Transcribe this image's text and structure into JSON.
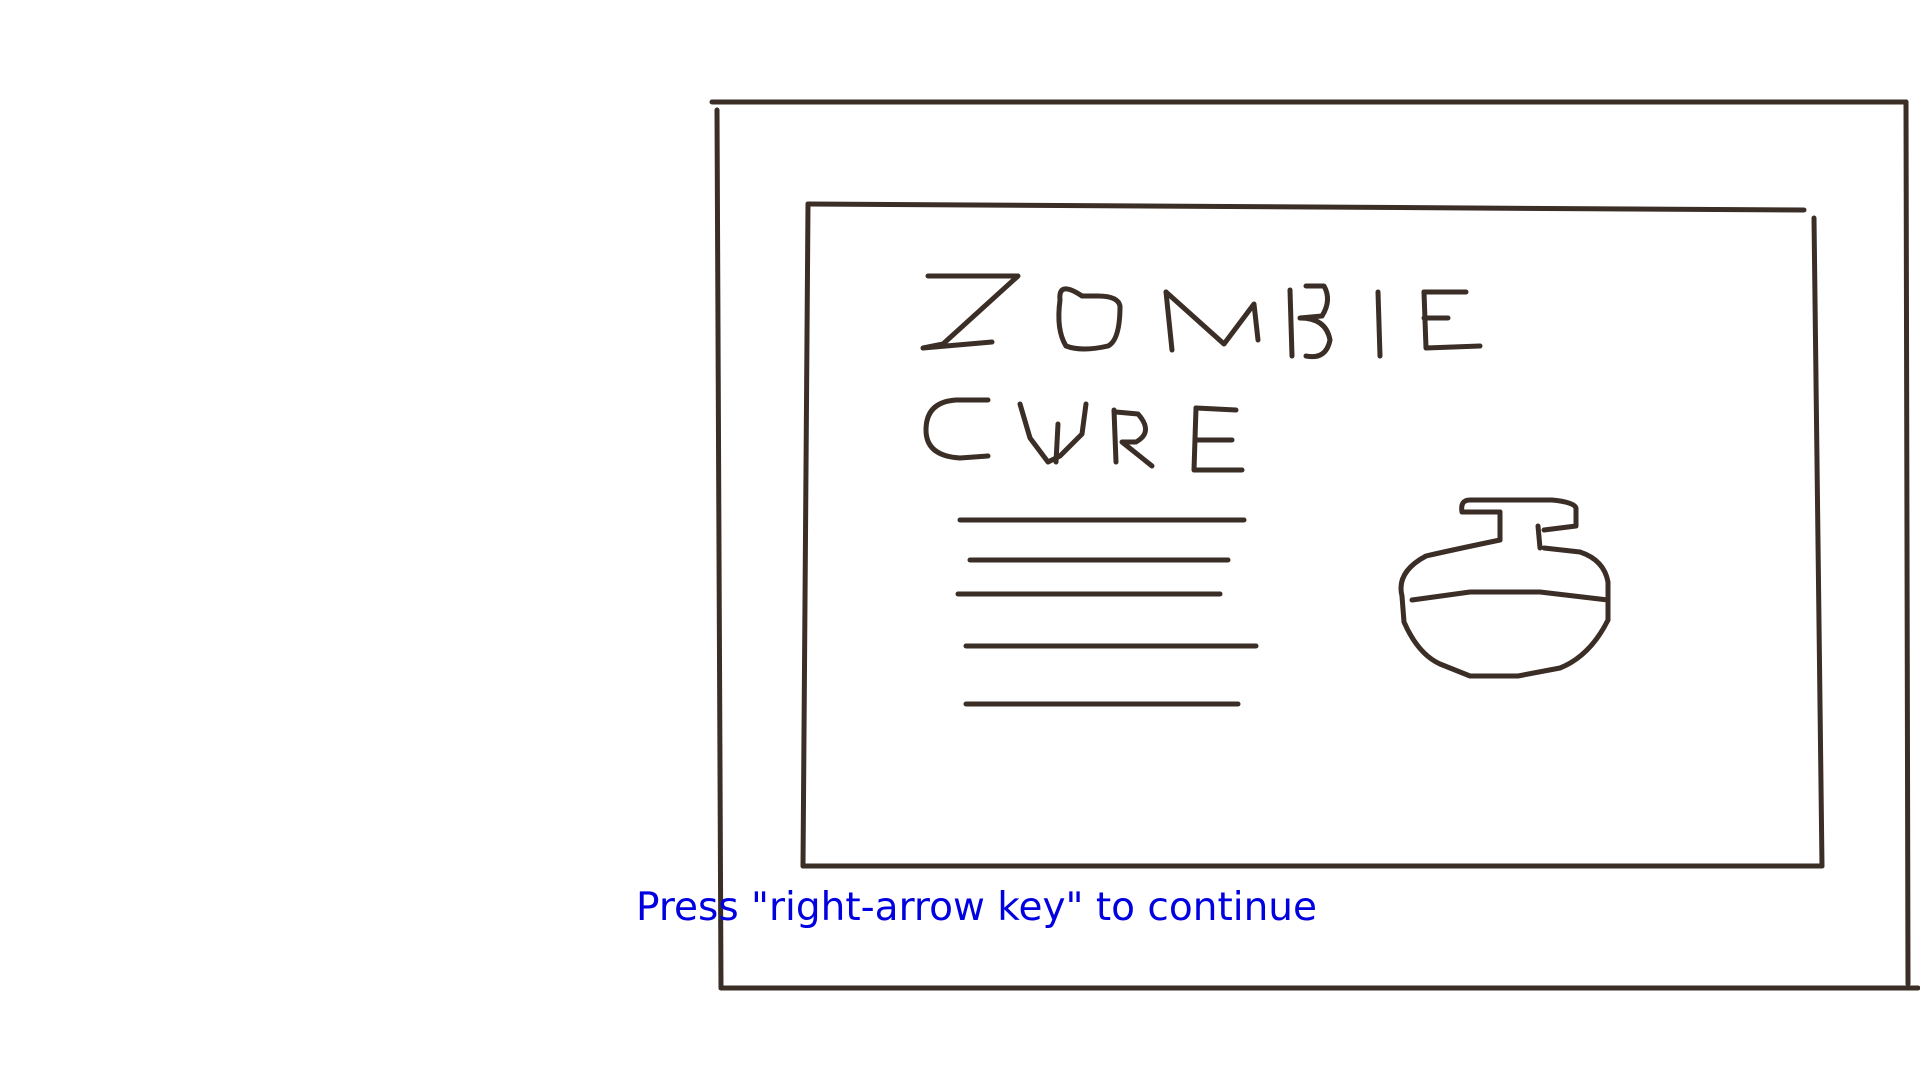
{
  "scene": {
    "prompt_text": "Press \"right-arrow key\" to continue",
    "prompt_color": "#0000e0",
    "ink_color": "#3a2e26",
    "sketch_subject": "book-icon",
    "book_title_line1": "ZOMBIE",
    "book_title_line2": "CURE",
    "illustration": "potion-flask-icon"
  }
}
